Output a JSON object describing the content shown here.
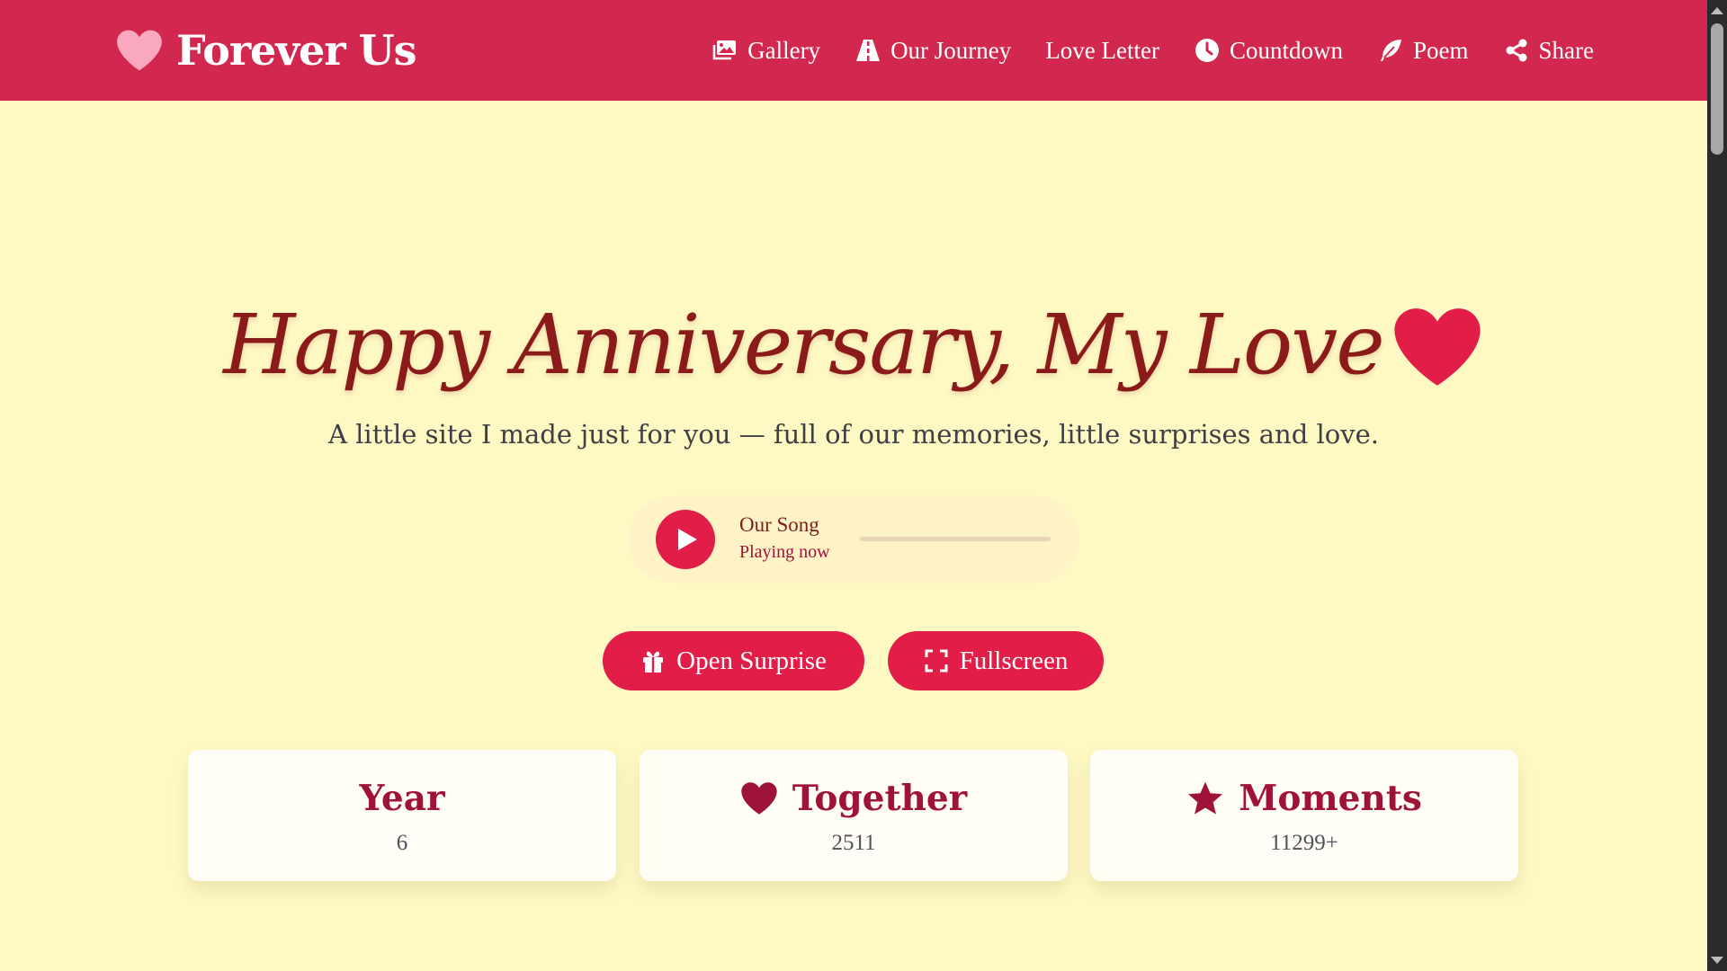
{
  "brand": {
    "name": "Forever Us",
    "icon": "heart-icon"
  },
  "nav": [
    {
      "label": "Gallery",
      "icon": "images-icon"
    },
    {
      "label": "Our Journey",
      "icon": "road-icon"
    },
    {
      "label": "Love Letter",
      "icon": ""
    },
    {
      "label": "Countdown",
      "icon": "clock-icon"
    },
    {
      "label": "Poem",
      "icon": "feather-icon"
    },
    {
      "label": "Share",
      "icon": "share-icon"
    }
  ],
  "hero": {
    "title": "Happy Anniversary, My Love",
    "subtitle": "A little site I made just for you — full of our memories, little surprises and love."
  },
  "player": {
    "title": "Our Song",
    "status": "Playing now",
    "progress": 0
  },
  "buttons": {
    "surprise": "Open Surprise",
    "fullscreen": "Fullscreen"
  },
  "stats": [
    {
      "title": "Year",
      "value": "6",
      "icon": ""
    },
    {
      "title": "Together",
      "value": "2511",
      "icon": "heart-icon"
    },
    {
      "title": "Moments",
      "value": "11299+",
      "icon": "star-icon"
    }
  ],
  "colors": {
    "header": "#d22850",
    "background": "#fef9c3",
    "accent": "#e11d48",
    "title": "#8b1a1a",
    "card_title": "#9f1239",
    "brand_heart": "#f9a8c0"
  }
}
